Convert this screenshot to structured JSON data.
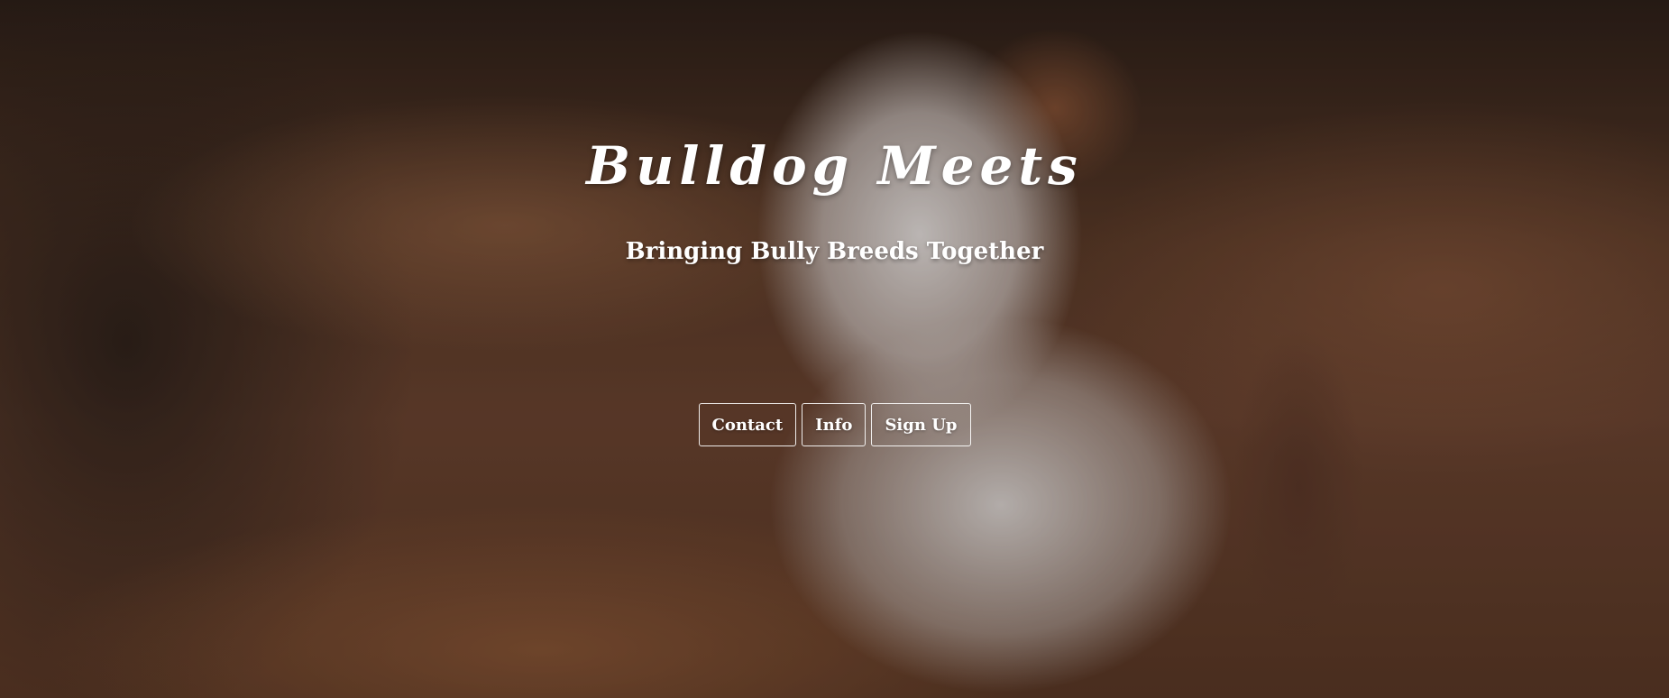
{
  "hero": {
    "title": "Bulldog Meets",
    "subtitle": "Bringing Bully Breeds Together"
  },
  "buttons": {
    "contact": "Contact",
    "info": "Info",
    "signup": "Sign Up"
  },
  "colors": {
    "text": "#ffffff",
    "button_border": "#ffffff"
  }
}
